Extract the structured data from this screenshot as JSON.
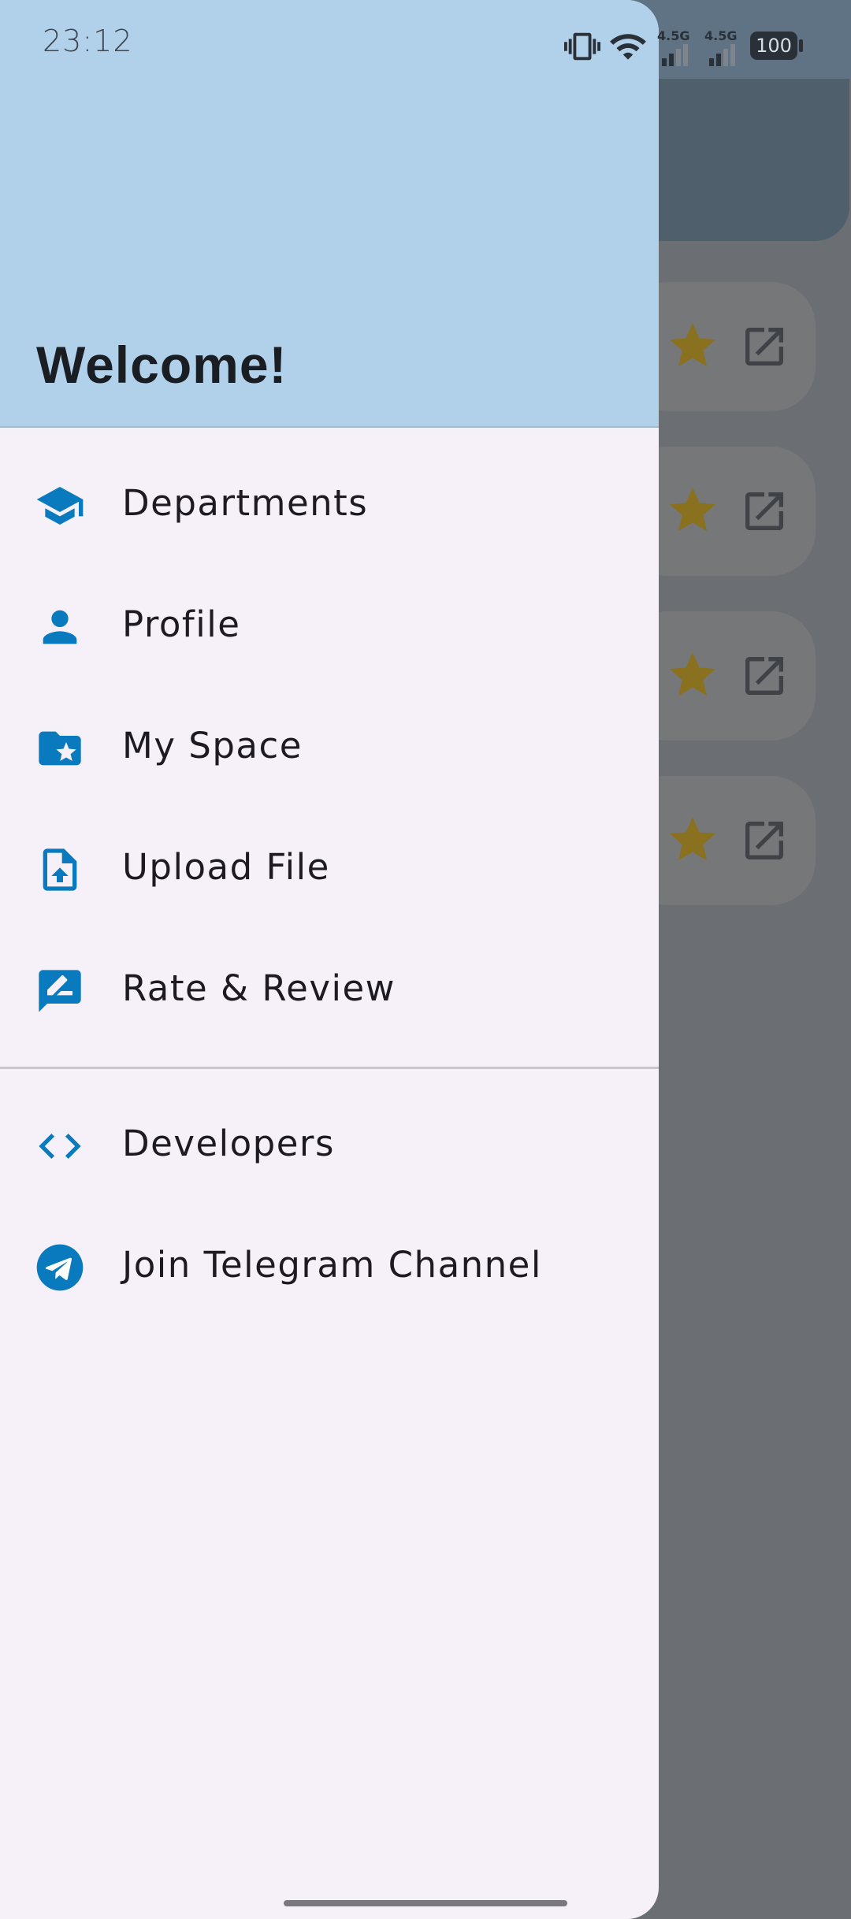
{
  "status_bar": {
    "time": "23:12",
    "network_1": "4.5G",
    "network_2": "4.5G",
    "battery": "100"
  },
  "drawer": {
    "header_title": "Welcome!",
    "primary_items": [
      {
        "label": "Departments",
        "icon": "school-icon"
      },
      {
        "label": "Profile",
        "icon": "person-icon"
      },
      {
        "label": "My Space",
        "icon": "folder-star-icon"
      },
      {
        "label": "Upload File",
        "icon": "file-upload-icon"
      },
      {
        "label": "Rate & Review",
        "icon": "rate-review-icon"
      }
    ],
    "secondary_items": [
      {
        "label": "Developers",
        "icon": "code-icon"
      },
      {
        "label": "Join Telegram Channel",
        "icon": "telegram-icon"
      }
    ]
  },
  "colors": {
    "header_bg": "#b1d0ea",
    "drawer_bg": "#f6f1f9",
    "icon_accent": "#0a7abf",
    "star": "#b8900a"
  }
}
